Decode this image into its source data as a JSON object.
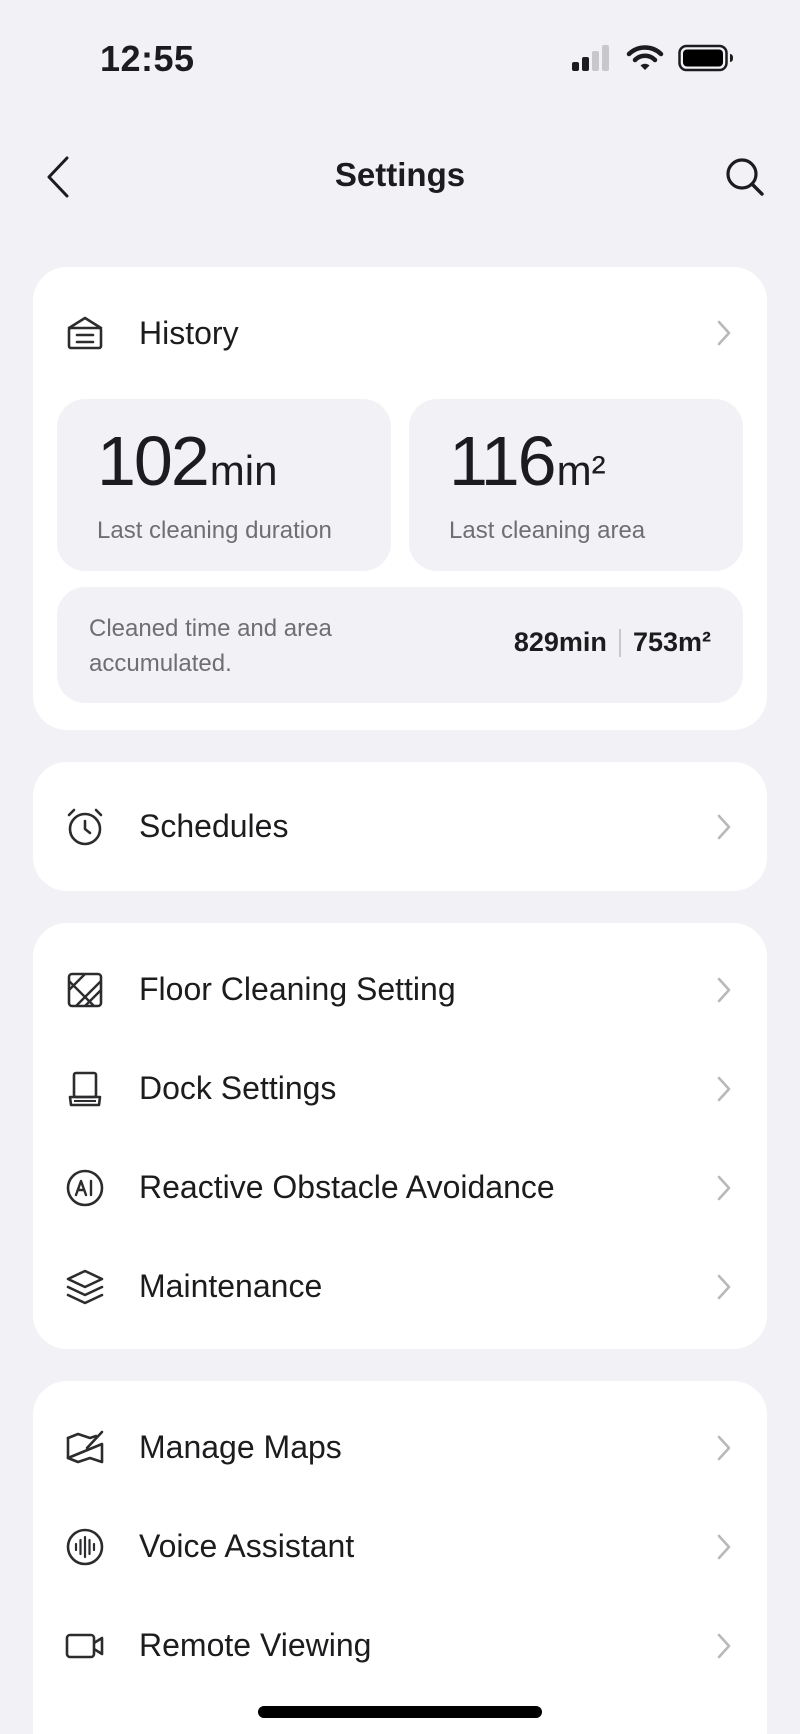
{
  "status_bar": {
    "time": "12:55"
  },
  "nav": {
    "title": "Settings"
  },
  "history": {
    "label": "History",
    "duration": {
      "value": "102",
      "unit": "min",
      "caption": "Last cleaning duration"
    },
    "area": {
      "value": "116",
      "unit": "m²",
      "caption": "Last cleaning area"
    },
    "accumulated": {
      "text": "Cleaned time and area accumulated.",
      "time_value": "829",
      "time_unit": "min",
      "area_value": "753",
      "area_unit": "m²"
    }
  },
  "schedules": {
    "label": "Schedules"
  },
  "group_cleaning": {
    "items": [
      {
        "label": "Floor Cleaning Setting",
        "icon": "floor-tile-icon"
      },
      {
        "label": "Dock Settings",
        "icon": "dock-icon"
      },
      {
        "label": "Reactive Obstacle Avoidance",
        "icon": "ai-icon"
      },
      {
        "label": "Maintenance",
        "icon": "layers-icon"
      }
    ]
  },
  "group_features": {
    "items": [
      {
        "label": "Manage Maps",
        "icon": "map-icon"
      },
      {
        "label": "Voice Assistant",
        "icon": "voice-wave-icon"
      },
      {
        "label": "Remote Viewing",
        "icon": "camera-icon"
      }
    ]
  },
  "colors": {
    "background": "#f2f2f6",
    "card": "#ffffff",
    "tile": "#f2f2f6",
    "text": "#1c1c1e",
    "secondary_text": "#6e6e73",
    "chevron": "#b8b8bd"
  }
}
